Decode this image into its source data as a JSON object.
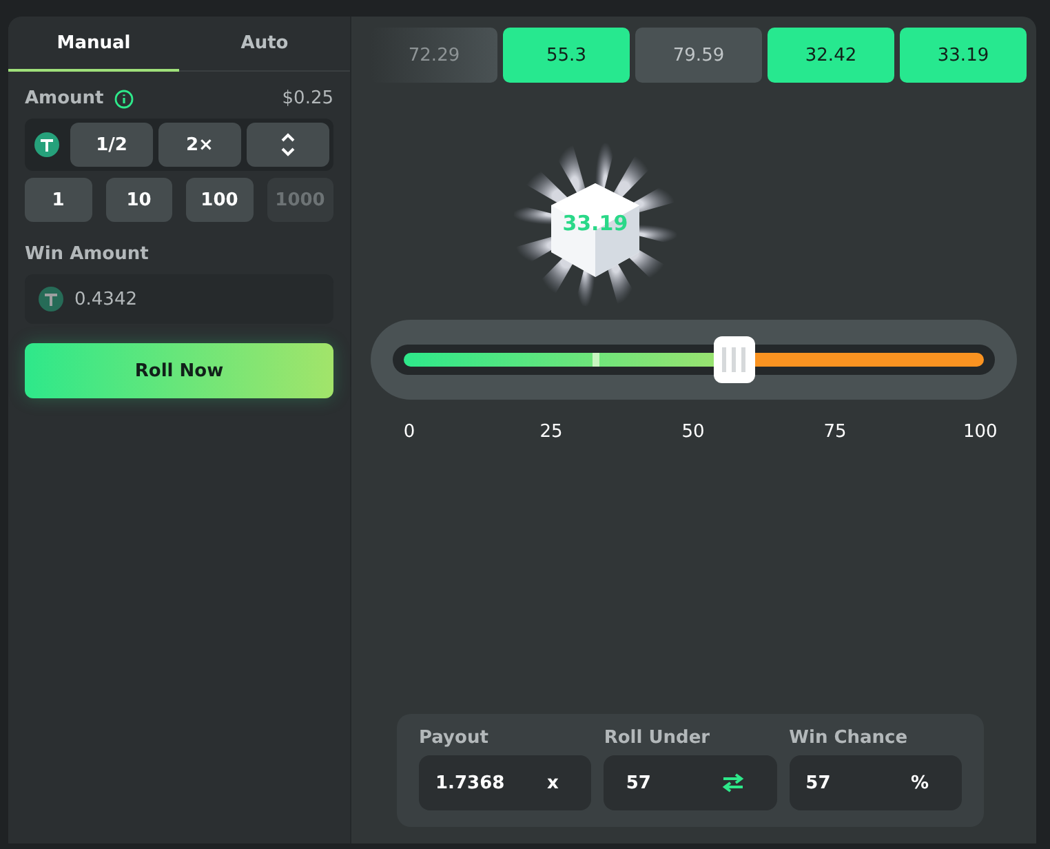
{
  "tabs": [
    {
      "label": "Manual",
      "selected": true
    },
    {
      "label": "Auto",
      "selected": false
    }
  ],
  "amount": {
    "label": "Amount",
    "value": "$0.25",
    "buttons": [
      {
        "label": "1/2"
      },
      {
        "label": "2×"
      }
    ]
  },
  "quick_amounts": [
    {
      "label": "1",
      "disabled": false
    },
    {
      "label": "10",
      "disabled": false
    },
    {
      "label": "100",
      "disabled": false
    },
    {
      "label": "1000",
      "disabled": true
    }
  ],
  "win_amount": {
    "label": "Win Amount",
    "value": "0.4342"
  },
  "roll_button": "Roll Now",
  "history": [
    {
      "value": "72.29",
      "win": false
    },
    {
      "value": "55.3",
      "win": true
    },
    {
      "value": "79.59",
      "win": false
    },
    {
      "value": "32.42",
      "win": true
    },
    {
      "value": "33.19",
      "win": true
    }
  ],
  "dice": {
    "value": "33.19"
  },
  "slider": {
    "level": 0.57,
    "result": {
      "level": 0.33
    },
    "ticks": [
      "0",
      "25",
      "50",
      "75",
      "100"
    ]
  },
  "stats": [
    {
      "kind": "payout",
      "label": "Payout",
      "value": "1.7368",
      "suffix": "x"
    },
    {
      "kind": "swap",
      "label": "Roll Under",
      "value": "57"
    },
    {
      "kind": "percent",
      "label": "Win Chance",
      "value": "57",
      "suffix": "%"
    }
  ]
}
